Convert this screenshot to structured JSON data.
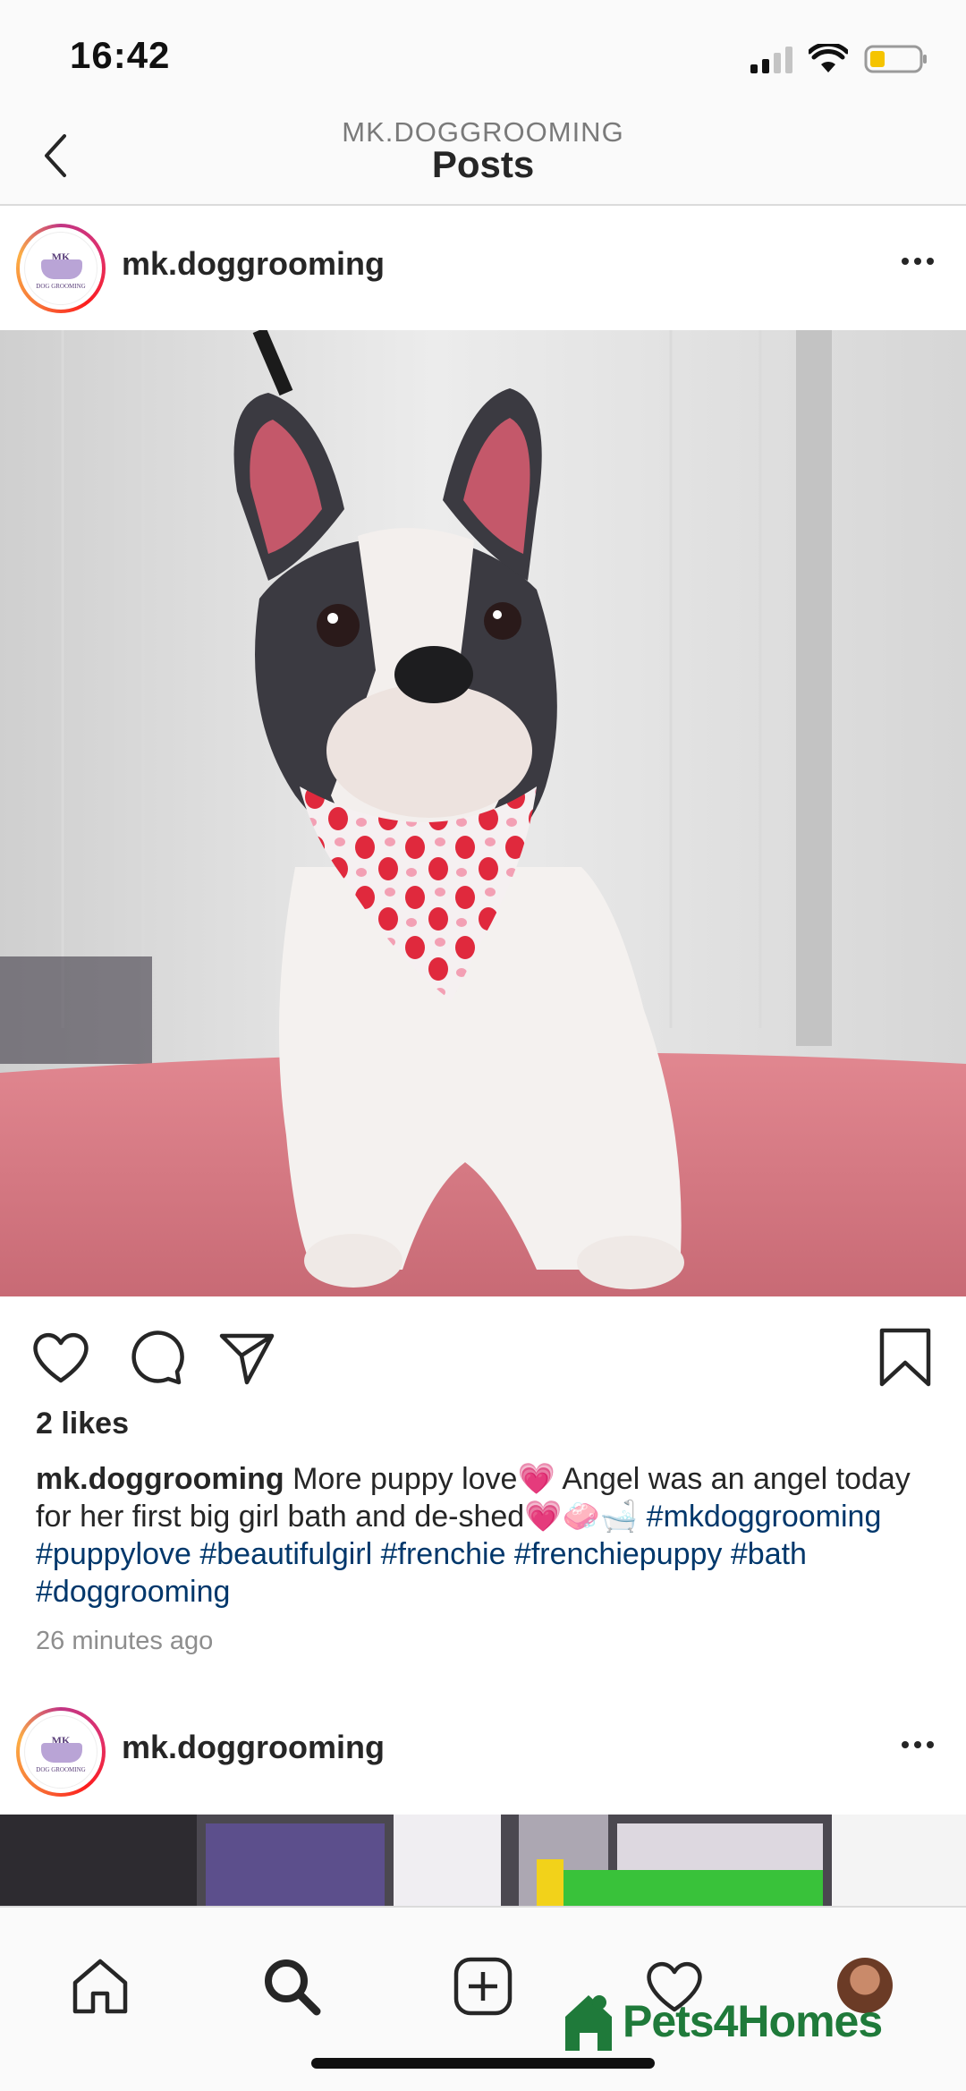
{
  "status_bar": {
    "time": "16:42"
  },
  "header": {
    "subtitle": "MK.DOGGROOMING",
    "title": "Posts"
  },
  "posts": [
    {
      "username": "mk.doggrooming",
      "likes": "2 likes",
      "caption_user": "mk.doggrooming",
      "caption_text": " More puppy love💗 Angel was an angel today for her first big girl bath and de-shed💗🧼🛁",
      "caption_tags": "#mkdoggrooming #puppylove #beautifulgirl #frenchie #frenchiepuppy #bath #doggrooming",
      "timestamp": "26 minutes ago"
    },
    {
      "username": "mk.doggrooming"
    }
  ],
  "avatar_logo": {
    "initials": "MK",
    "text": "DOG GROOMING"
  },
  "watermark": {
    "text": "Pets4Homes"
  },
  "colors": {
    "hashtag": "#00376b",
    "watermark": "#1f7a3a",
    "table_pink": "#d9737f"
  },
  "icons": {
    "status": [
      "signal-icon",
      "wifi-icon",
      "battery-icon"
    ],
    "post_actions": [
      "heart-icon",
      "comment-icon",
      "share-icon",
      "bookmark-icon"
    ],
    "tab_bar": [
      "home-icon",
      "search-icon",
      "add-post-icon",
      "activity-heart-icon",
      "profile-avatar"
    ]
  }
}
